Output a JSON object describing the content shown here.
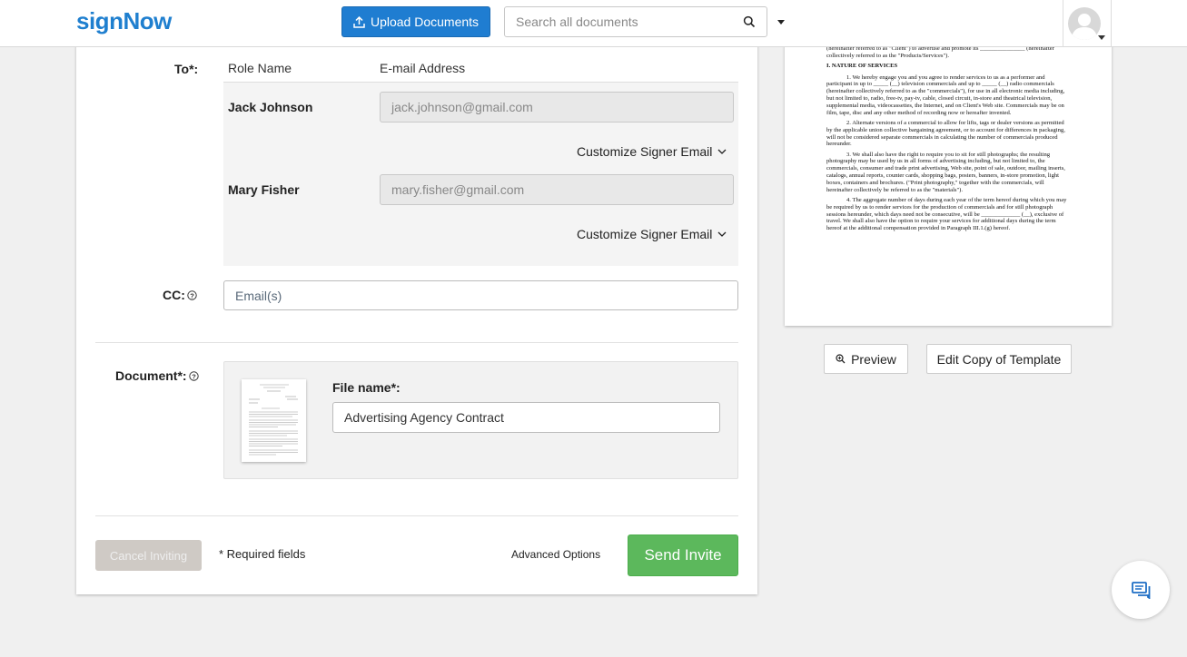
{
  "header": {
    "logo": "signNow",
    "upload_label": "Upload Documents",
    "search_placeholder": "Search all documents"
  },
  "invite_form": {
    "to_label": "To*:",
    "columns": {
      "role_name": "Role Name",
      "email": "E-mail Address"
    },
    "signers": [
      {
        "name": "Jack Johnson",
        "email": "jack.johnson@gmail.com",
        "customize_label": "Customize Signer Email"
      },
      {
        "name": "Mary Fisher",
        "email": "mary.fisher@gmail.com",
        "customize_label": "Customize Signer Email"
      }
    ],
    "cc_label": "CC:",
    "cc_placeholder": "Email(s)",
    "document_label": "Document*:",
    "file_name_label": "File name*:",
    "file_name_value": "Advertising Agency Contract",
    "cancel_label": "Cancel Inviting",
    "required_note": "* Required fields",
    "advanced_options_label": "Advanced Options",
    "send_label": "Send Invite"
  },
  "preview": {
    "lines": [
      "agreement between you and us with respect to your rendering services to us on behalf of our client (hereinafter referred to as \"Client\") to advertise and promote its _______________ (hereinafter collectively referred to as the \"Products/Services\").",
      "I. NATURE OF SERVICES",
      "1. We hereby engage you and you agree to render services to us as a performer and participant in up to _____ (__) television commercials and up to _____ (__) radio commercials (hereinafter collectively referred to as the \"commercials\"), for use in all electronic media including, but not limited to, radio, free-tv, pay-tv, cable, closed circuit, in-store and theatrical television, supplemental media, videocassettes, the Internet, and on Client's Web site. Commercials may be on film, tape, disc and any other method of recording now or hereafter invented.",
      "2. Alternate versions of a commercial to allow for lifts, tags or dealer versions as permitted by the applicable union collective bargaining agreement, or to account for differences in packaging, will not be considered separate commercials in calculating the number of commercials produced hereunder.",
      "3. We shall also have the right to require you to sit for still photographs; the resulting photography may be used by us in all forms of advertising including, but not limited to, the commercials, consumer and trade print advertising, Web site, point of sale, outdoor, mailing inserts, catalogs, annual reports, counter cards, shopping bags, posters, banners, in-store promotion, light boxes, containers and brochures. (\"Print photography,\" together with the commercials, will hereinafter collectively be referred to as the \"materials\").",
      "4. The aggregate number of days during each year of the term hereof during which you may be required by us to render services for the production of commercials and for still photograph sessions hereunder, which days need not be consecutive, will be _____________ (__), exclusive of travel. We shall also have the option to require your services for additional days during the term hereof at the additional compensation provided in Paragraph III.1.(g) hereof."
    ],
    "preview_label": "Preview",
    "edit_copy_label": "Edit Copy of Template"
  }
}
